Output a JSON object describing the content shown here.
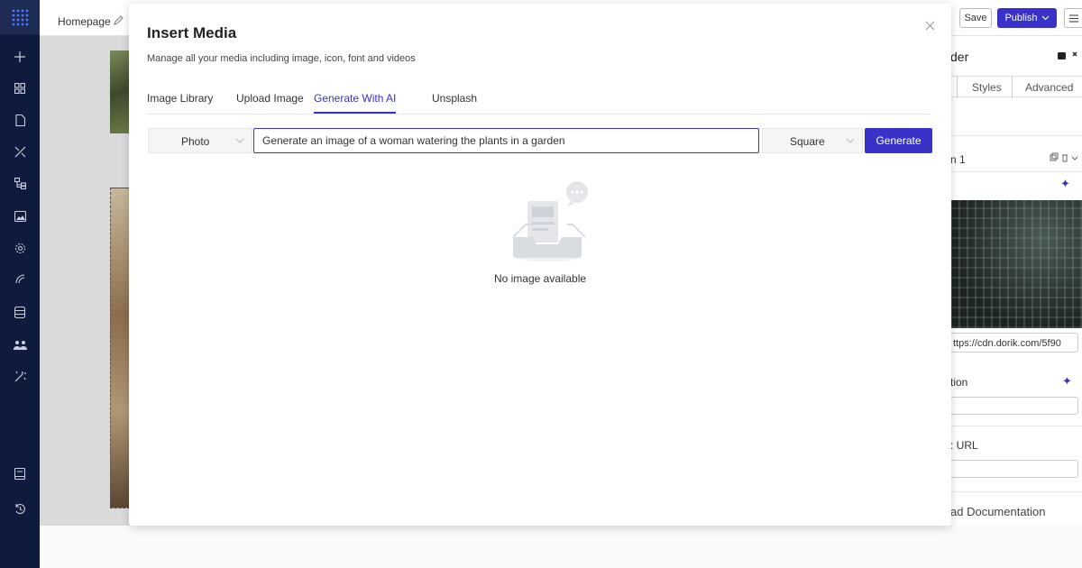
{
  "topbar": {
    "page_name": "Homepage",
    "save_label": "Save",
    "publish_label": "Publish"
  },
  "right_panel": {
    "title_fragment": "der",
    "tabs": [
      "Styles",
      "Advanced"
    ],
    "item_label": "n 1",
    "url_value": "ttps://cdn.dorik.com/5f90",
    "field1_label": "tion",
    "field2_label": ": URL",
    "doc_link": "ad Documentation"
  },
  "modal": {
    "title": "Insert Media",
    "subtitle": "Manage all your media including image, icon, font and videos",
    "tabs": [
      {
        "label": "Image Library",
        "active": false
      },
      {
        "label": "Upload Image",
        "active": false
      },
      {
        "label": "Generate With AI",
        "active": true
      },
      {
        "label": "Unsplash",
        "active": false
      }
    ],
    "type_select": "Photo",
    "prompt_value": "Generate an image of a woman watering the plants in a garden",
    "ratio_select": "Square",
    "generate_label": "Generate",
    "empty_text": "No image available"
  },
  "colors": {
    "accent": "#3832c9",
    "rail": "#0f1b3d"
  },
  "icons": {
    "rail": [
      "logo-grid-icon",
      "plus-icon",
      "blocks-icon",
      "page-icon",
      "tools-icon",
      "layers-icon",
      "image-icon",
      "settings-icon",
      "integrations-icon",
      "database-icon",
      "users-icon",
      "magic-icon",
      "book-icon",
      "history-icon"
    ]
  }
}
